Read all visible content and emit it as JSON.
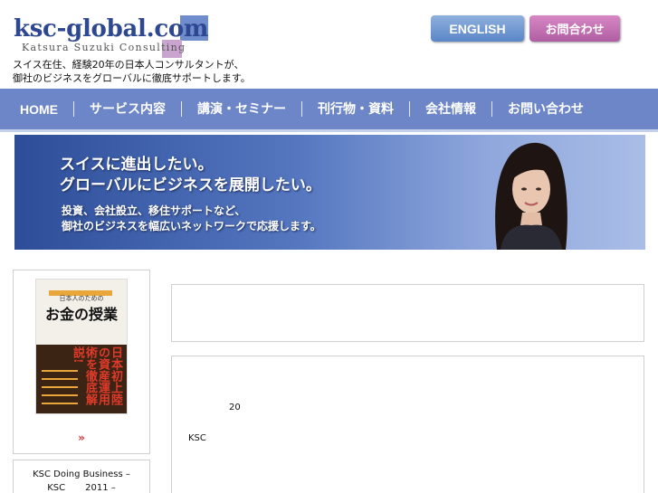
{
  "header": {
    "logo_text": "ksc-global.com",
    "logo_sub": "Katsura Suzuki Consulting",
    "tagline_line1": "スイス在住、経験20年の日本人コンサルタントが、",
    "tagline_line2": "御社のビジネスをグローバルに徹底サポートします。",
    "english_button": "ENGLISH",
    "contact_button": "お問合わせ"
  },
  "nav": {
    "items": [
      {
        "label": "HOME"
      },
      {
        "label": "サービス内容"
      },
      {
        "label": "講演・セミナー"
      },
      {
        "label": "刊行物・資料"
      },
      {
        "label": "会社情報"
      },
      {
        "label": "お問い合わせ"
      }
    ]
  },
  "banner": {
    "headline_line1": "スイスに進出したい。",
    "headline_line2": "グローバルにビジネスを展開したい。",
    "body_line1": "投資、会社設立、移住サポートなど、",
    "body_line2": "御社のビジネスを幅広いネットワークで応援します。"
  },
  "sidebar": {
    "book": {
      "subtitle": "日本人のための",
      "title": "お金の授業",
      "spine_text": "日本初上陸の資産運用術を徹底解説!"
    },
    "more_arrow": "»",
    "news_line1": "KSC Doing Business –",
    "news_line2_a": "KSC",
    "news_line2_b": "2011 –"
  },
  "main": {
    "number_text": "20",
    "ksc_text": "KSC"
  },
  "colors": {
    "nav_bg": "#6d86c8",
    "logo_blue": "#2d4790",
    "english_btn": "#5a86c8",
    "contact_btn": "#b05ea3"
  }
}
